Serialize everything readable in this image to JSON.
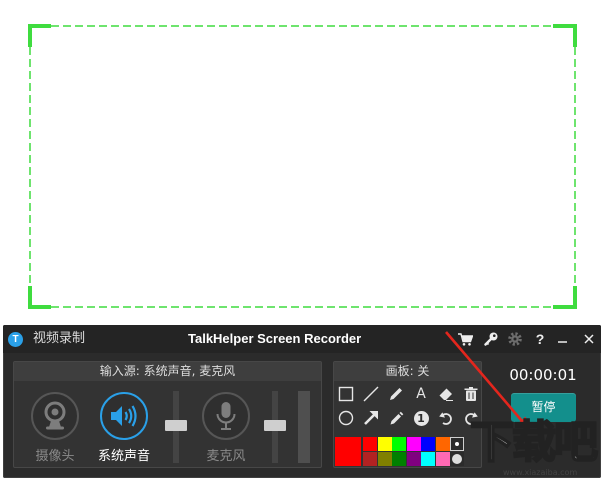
{
  "capture_region": {
    "border_color": "#3fdc3f"
  },
  "recorder": {
    "logo_letter": "T",
    "mode_label": "视频录制",
    "title": "TalkHelper Screen Recorder",
    "title_bar_icons": [
      "cart-icon",
      "key-icon",
      "gear-icon",
      "help-icon",
      "minimize-icon",
      "close-icon"
    ],
    "help_label": "?",
    "input_panel": {
      "header": "输入源: 系统声音, 麦克风",
      "sources": [
        {
          "label": "摄像头",
          "icon": "webcam-icon",
          "active": false
        },
        {
          "label": "系统声音",
          "icon": "speaker-icon",
          "active": true
        },
        {
          "label": "麦克风",
          "icon": "microphone-icon",
          "active": false
        }
      ],
      "system_audio_volume": 0.52,
      "microphone_volume": 0.52
    },
    "draw_panel": {
      "header": "画板: 关",
      "tools": [
        "rectangle-icon",
        "line-icon",
        "pencil-icon",
        "text-icon",
        "eraser-icon",
        "trash-icon",
        "ellipse-icon",
        "arrow-icon",
        "marker-icon",
        "number-icon",
        "undo-icon",
        "redo-icon"
      ],
      "text_tool_glyph": "A",
      "number_tool_glyph": "1",
      "current_color": "#ff0000",
      "palette": [
        "#ff0000",
        "#ffff00",
        "#00ff00",
        "#ff00ff",
        "#0000ff",
        "#ff6600",
        "#b22222",
        "#808000",
        "#008000",
        "#800080",
        "#00ffff",
        "#ff69b4"
      ]
    },
    "timer": "00:00:01",
    "pause_label": "暂停"
  },
  "colors": {
    "accent": "#2aa0e8",
    "pause_button": "#138f8c",
    "annotation_arrow": "#e3261d"
  },
  "watermark": {
    "text": "下载吧",
    "url": "www.xiazaiba.com"
  }
}
